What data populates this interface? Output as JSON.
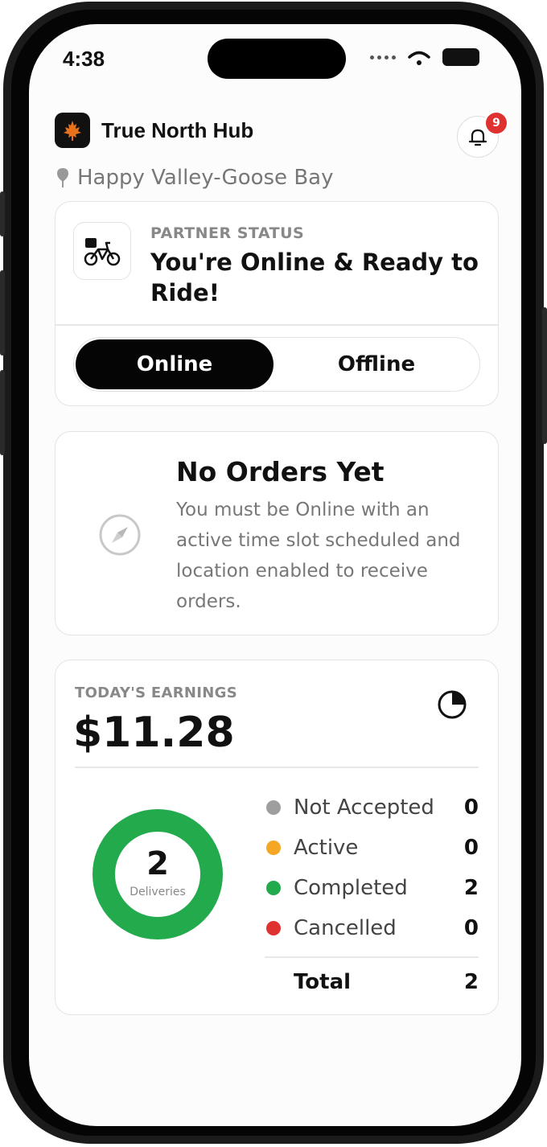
{
  "status_bar": {
    "time": "4:38"
  },
  "app": {
    "name": "True North Hub",
    "notification_count": "9",
    "location": "Happy Valley-Goose Bay"
  },
  "partner": {
    "label": "PARTNER STATUS",
    "title": "You're Online & Ready to Ride!",
    "toggle": {
      "online": "Online",
      "offline": "Offline",
      "selected": "Online"
    }
  },
  "orders": {
    "title": "No Orders Yet",
    "description": "You must be Online with an active time slot scheduled and location enabled to receive orders."
  },
  "earnings": {
    "label": "TODAY'S EARNINGS",
    "amount": "$11.28",
    "deliveries": {
      "count": "2",
      "label": "Deliveries"
    },
    "breakdown": [
      {
        "label": "Not Accepted",
        "value": "0",
        "color": "#9e9e9e"
      },
      {
        "label": "Active",
        "value": "0",
        "color": "#f5a623"
      },
      {
        "label": "Completed",
        "value": "2",
        "color": "#22aa4d"
      },
      {
        "label": "Cancelled",
        "value": "0",
        "color": "#e03131"
      }
    ],
    "total": {
      "label": "Total",
      "value": "2"
    }
  },
  "icons": {
    "logo": "maple-leaf-icon",
    "notifications": "bell-icon",
    "location": "map-pin-icon",
    "partner": "delivery-bike-icon",
    "orders": "compass-icon",
    "earnings": "pie-chart-icon"
  },
  "colors": {
    "brand": "#e8711c",
    "toggle_active": "#050505",
    "badge": "#e03131",
    "donut": "#22aa4d"
  }
}
